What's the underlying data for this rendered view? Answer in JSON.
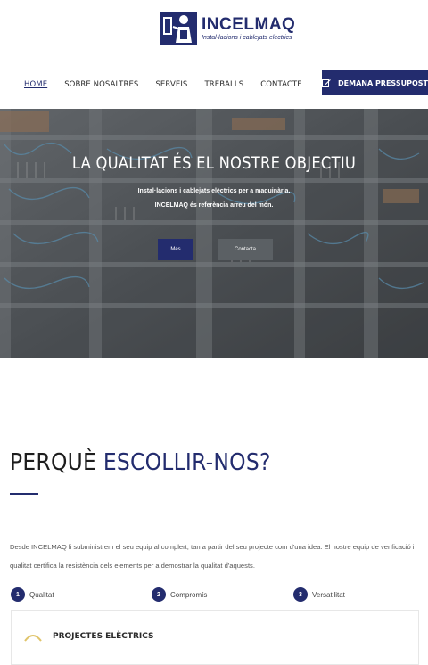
{
  "brand": {
    "name": "INCELMAQ",
    "tagline": "Instal·lacions i cablejats elèctrics"
  },
  "nav": {
    "items": [
      "HOME",
      "SOBRE NOSALTRES",
      "SERVEIS",
      "TREBALLS",
      "CONTACTE"
    ],
    "active_index": 0,
    "cta_label": "DEMANA PRESSUPOST",
    "cta_icon": "edit-icon"
  },
  "hero": {
    "title": "LA QUALITAT ÉS EL NOSTRE OBJECTIU",
    "line1": "Instal·lacions i cablejats elèctrics per a maquinària.",
    "line2": "INCELMAQ és referència arreu del món.",
    "btn_primary": "Més",
    "btn_secondary": "Contacta"
  },
  "why": {
    "title_part1": "PERQUÈ",
    "title_part2": "ESCOLLIR-NOS?",
    "text": "Desde INCELMAQ li subministrem el seu equip al complert, tan a partir del seu projecte com d'una idea. El nostre equip de verificació i qualitat certifica la resistència dels elements per a demostrar la qualitat d'aquests.",
    "steps": [
      {
        "num": "1",
        "label": "Qualitat"
      },
      {
        "num": "2",
        "label": "Compromís"
      },
      {
        "num": "3",
        "label": "Versatilitat"
      }
    ]
  },
  "card": {
    "title": "PROJECTES ELÈCTRICS"
  },
  "colors": {
    "brand": "#232c6e",
    "secondary_button": "#5b6064"
  }
}
